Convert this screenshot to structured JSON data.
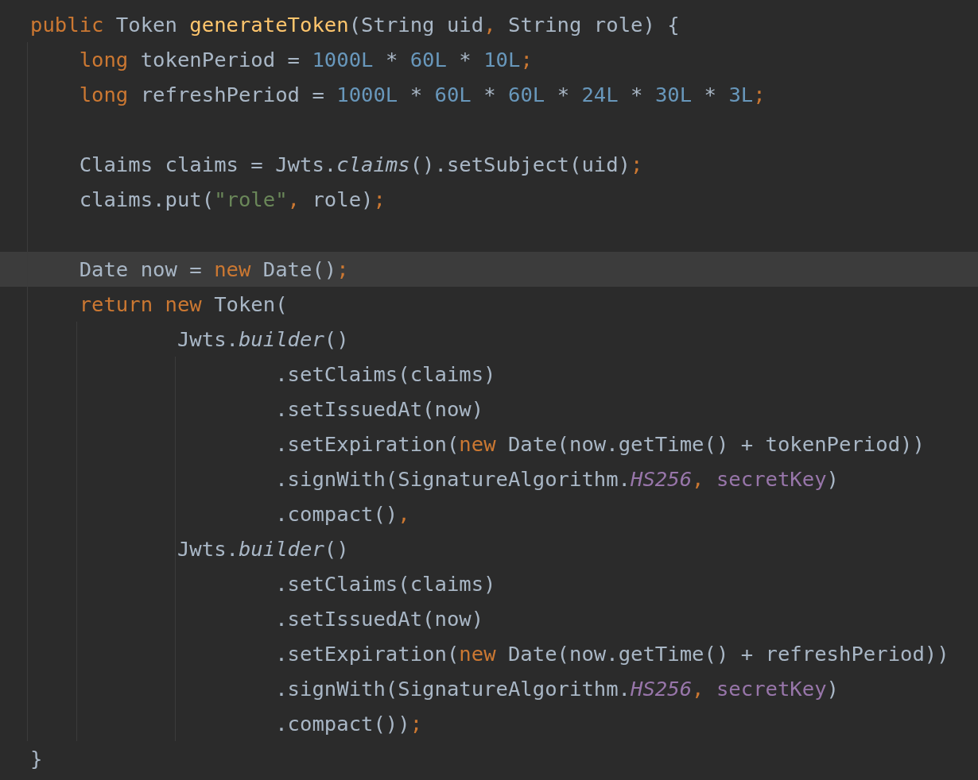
{
  "editor": {
    "lines": [
      {
        "kind": "code",
        "current": false,
        "tokens": [
          {
            "text": "public",
            "kind": "keyword"
          },
          {
            "text": " Token ",
            "kind": "plain"
          },
          {
            "text": "generateToken",
            "kind": "declaration"
          },
          {
            "text": "(String uid",
            "kind": "plain"
          },
          {
            "text": ",",
            "kind": "punct"
          },
          {
            "text": " String role) {",
            "kind": "plain"
          }
        ]
      },
      {
        "kind": "code",
        "current": false,
        "tokens": [
          {
            "text": "    long",
            "kind": "keyword"
          },
          {
            "text": " tokenPeriod = ",
            "kind": "plain"
          },
          {
            "text": "1000L",
            "kind": "number"
          },
          {
            "text": " * ",
            "kind": "plain"
          },
          {
            "text": "60L",
            "kind": "number"
          },
          {
            "text": " * ",
            "kind": "plain"
          },
          {
            "text": "10L",
            "kind": "number"
          },
          {
            "text": ";",
            "kind": "punct"
          }
        ]
      },
      {
        "kind": "code",
        "current": false,
        "tokens": [
          {
            "text": "    long",
            "kind": "keyword"
          },
          {
            "text": " refreshPeriod = ",
            "kind": "plain"
          },
          {
            "text": "1000L",
            "kind": "number"
          },
          {
            "text": " * ",
            "kind": "plain"
          },
          {
            "text": "60L",
            "kind": "number"
          },
          {
            "text": " * ",
            "kind": "plain"
          },
          {
            "text": "60L",
            "kind": "number"
          },
          {
            "text": " * ",
            "kind": "plain"
          },
          {
            "text": "24L",
            "kind": "number"
          },
          {
            "text": " * ",
            "kind": "plain"
          },
          {
            "text": "30L",
            "kind": "number"
          },
          {
            "text": " * ",
            "kind": "plain"
          },
          {
            "text": "3L",
            "kind": "number"
          },
          {
            "text": ";",
            "kind": "punct"
          }
        ]
      },
      {
        "kind": "blank",
        "current": false
      },
      {
        "kind": "code",
        "current": false,
        "tokens": [
          {
            "text": "    Claims claims = Jwts.",
            "kind": "plain"
          },
          {
            "text": "claims",
            "kind": "static"
          },
          {
            "text": "().setSubject(uid)",
            "kind": "plain"
          },
          {
            "text": ";",
            "kind": "punct"
          }
        ]
      },
      {
        "kind": "code",
        "current": false,
        "tokens": [
          {
            "text": "    claims.put(",
            "kind": "plain"
          },
          {
            "text": "\"role\"",
            "kind": "string"
          },
          {
            "text": ",",
            "kind": "punct"
          },
          {
            "text": " role)",
            "kind": "plain"
          },
          {
            "text": ";",
            "kind": "punct"
          }
        ]
      },
      {
        "kind": "blank",
        "current": false
      },
      {
        "kind": "code",
        "current": true,
        "tokens": [
          {
            "text": "    Date now = ",
            "kind": "plain"
          },
          {
            "text": "new",
            "kind": "keyword"
          },
          {
            "text": " Date()",
            "kind": "plain"
          },
          {
            "text": ";",
            "kind": "punct"
          }
        ]
      },
      {
        "kind": "code",
        "current": false,
        "tokens": [
          {
            "text": "    return new",
            "kind": "keyword"
          },
          {
            "text": " Token(",
            "kind": "plain"
          }
        ]
      },
      {
        "kind": "code",
        "current": false,
        "tokens": [
          {
            "text": "            Jwts.",
            "kind": "plain"
          },
          {
            "text": "builder",
            "kind": "static"
          },
          {
            "text": "()",
            "kind": "plain"
          }
        ]
      },
      {
        "kind": "code",
        "current": false,
        "tokens": [
          {
            "text": "                    .setClaims(claims)",
            "kind": "plain"
          }
        ]
      },
      {
        "kind": "code",
        "current": false,
        "tokens": [
          {
            "text": "                    .setIssuedAt(now)",
            "kind": "plain"
          }
        ]
      },
      {
        "kind": "code",
        "current": false,
        "tokens": [
          {
            "text": "                    .setExpiration(",
            "kind": "plain"
          },
          {
            "text": "new",
            "kind": "keyword"
          },
          {
            "text": " Date(now.getTime() + tokenPeriod))",
            "kind": "plain"
          }
        ]
      },
      {
        "kind": "code",
        "current": false,
        "tokens": [
          {
            "text": "                    .signWith(SignatureAlgorithm.",
            "kind": "plain"
          },
          {
            "text": "HS256",
            "kind": "constant"
          },
          {
            "text": ",",
            "kind": "punct"
          },
          {
            "text": " secretKey",
            "kind": "field"
          },
          {
            "text": ")",
            "kind": "plain"
          }
        ]
      },
      {
        "kind": "code",
        "current": false,
        "tokens": [
          {
            "text": "                    .compact()",
            "kind": "plain"
          },
          {
            "text": ",",
            "kind": "punct"
          }
        ]
      },
      {
        "kind": "code",
        "current": false,
        "tokens": [
          {
            "text": "            Jwts.",
            "kind": "plain"
          },
          {
            "text": "builder",
            "kind": "static"
          },
          {
            "text": "()",
            "kind": "plain"
          }
        ]
      },
      {
        "kind": "code",
        "current": false,
        "tokens": [
          {
            "text": "                    .setClaims(claims)",
            "kind": "plain"
          }
        ]
      },
      {
        "kind": "code",
        "current": false,
        "tokens": [
          {
            "text": "                    .setIssuedAt(now)",
            "kind": "plain"
          }
        ]
      },
      {
        "kind": "code",
        "current": false,
        "tokens": [
          {
            "text": "                    .setExpiration(",
            "kind": "plain"
          },
          {
            "text": "new",
            "kind": "keyword"
          },
          {
            "text": " Date(now.getTime() + refreshPeriod))",
            "kind": "plain"
          }
        ]
      },
      {
        "kind": "code",
        "current": false,
        "tokens": [
          {
            "text": "                    .signWith(SignatureAlgorithm.",
            "kind": "plain"
          },
          {
            "text": "HS256",
            "kind": "constant"
          },
          {
            "text": ",",
            "kind": "punct"
          },
          {
            "text": " secretKey",
            "kind": "field"
          },
          {
            "text": ")",
            "kind": "plain"
          }
        ]
      },
      {
        "kind": "code",
        "current": false,
        "tokens": [
          {
            "text": "                    .compact())",
            "kind": "plain"
          },
          {
            "text": ";",
            "kind": "punct"
          }
        ]
      },
      {
        "kind": "code",
        "current": false,
        "tokens": [
          {
            "text": "}",
            "kind": "plain"
          }
        ]
      }
    ]
  }
}
